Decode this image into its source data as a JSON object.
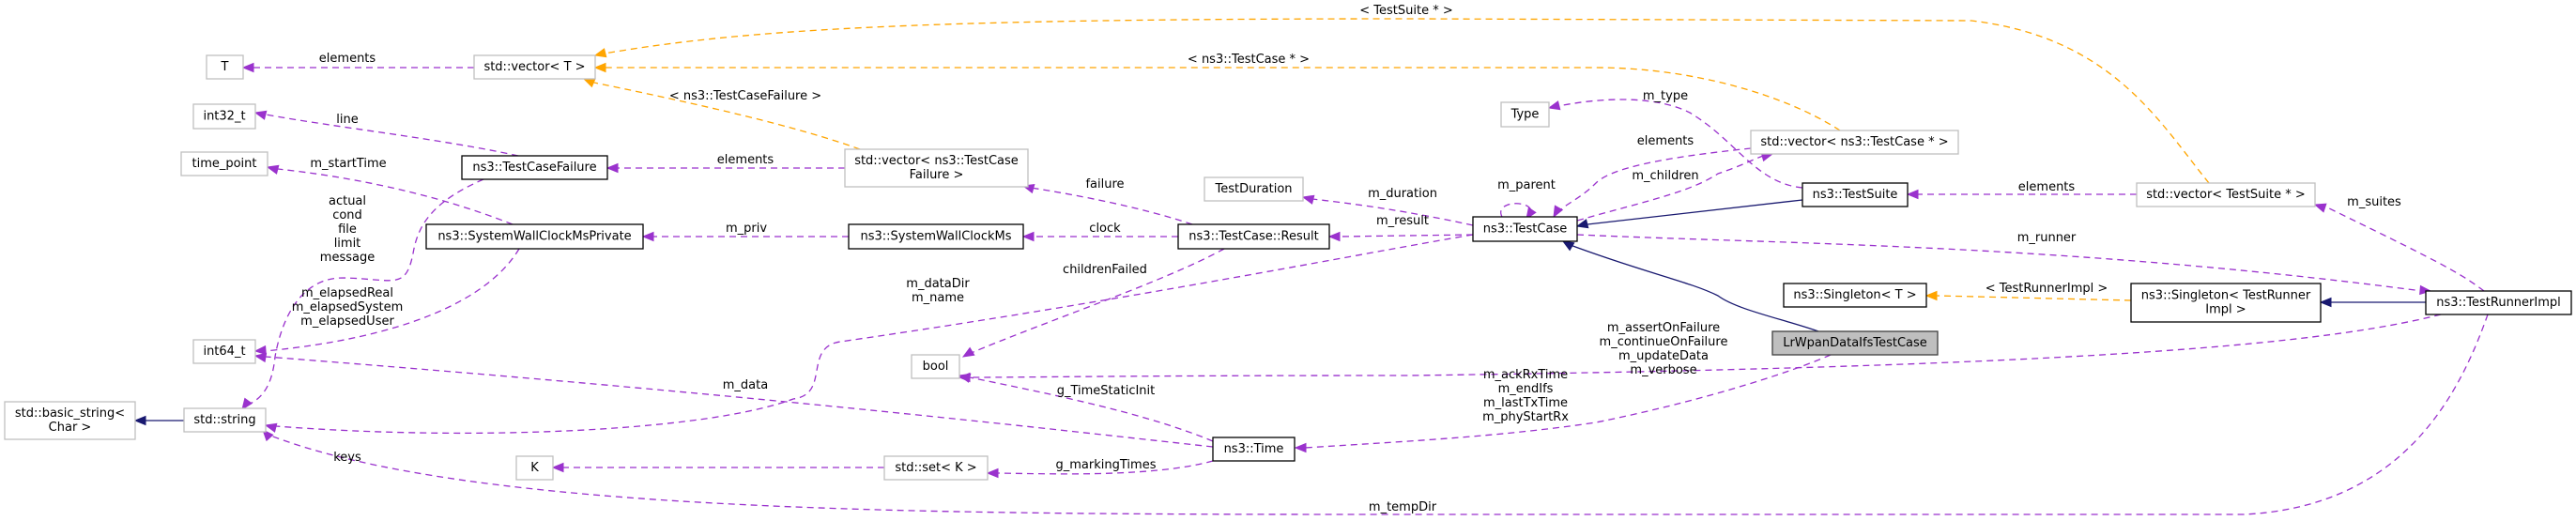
{
  "title": "LrWpanDataIfsTestCase collaboration diagram",
  "colors": {
    "usage_edge": "#9a32cd",
    "template_edge": "#ffa500",
    "inherit_edge": "#191970",
    "focus_fill": "#bfbfbf",
    "undocumented_border": "#bfbfbf",
    "documented_border": "#000000"
  },
  "nodes": [
    {
      "id": "T",
      "lines": [
        "T"
      ],
      "kind": "undoc"
    },
    {
      "id": "vectorT",
      "lines": [
        "std::vector< T >"
      ],
      "kind": "undoc"
    },
    {
      "id": "int32",
      "lines": [
        "int32_t"
      ],
      "kind": "undoc"
    },
    {
      "id": "timepoint",
      "lines": [
        "time_point"
      ],
      "kind": "undoc"
    },
    {
      "id": "tcfailure",
      "lines": [
        "ns3::TestCaseFailure"
      ],
      "kind": "doc"
    },
    {
      "id": "swcmp",
      "lines": [
        "ns3::SystemWallClockMsPrivate"
      ],
      "kind": "doc"
    },
    {
      "id": "int64",
      "lines": [
        "int64_t"
      ],
      "kind": "undoc"
    },
    {
      "id": "basicstring",
      "lines": [
        "std::basic_string<",
        "Char >"
      ],
      "kind": "undoc"
    },
    {
      "id": "string",
      "lines": [
        "std::string"
      ],
      "kind": "undoc"
    },
    {
      "id": "K",
      "lines": [
        "K"
      ],
      "kind": "undoc"
    },
    {
      "id": "vecfailure",
      "lines": [
        "std::vector< ns3::TestCase",
        "Failure >"
      ],
      "kind": "undoc"
    },
    {
      "id": "swcm",
      "lines": [
        "ns3::SystemWallClockMs"
      ],
      "kind": "doc"
    },
    {
      "id": "duration",
      "lines": [
        "TestDuration"
      ],
      "kind": "undoc"
    },
    {
      "id": "result",
      "lines": [
        "ns3::TestCase::Result"
      ],
      "kind": "doc"
    },
    {
      "id": "bool",
      "lines": [
        "bool"
      ],
      "kind": "undoc"
    },
    {
      "id": "time",
      "lines": [
        "ns3::Time"
      ],
      "kind": "doc"
    },
    {
      "id": "setK",
      "lines": [
        "std::set< K >"
      ],
      "kind": "undoc"
    },
    {
      "id": "type",
      "lines": [
        "Type"
      ],
      "kind": "undoc"
    },
    {
      "id": "testcase",
      "lines": [
        "ns3::TestCase"
      ],
      "kind": "doc"
    },
    {
      "id": "vectc",
      "lines": [
        "std::vector< ns3::TestCase * >"
      ],
      "kind": "undoc"
    },
    {
      "id": "testsuite",
      "lines": [
        "ns3::TestSuite"
      ],
      "kind": "doc"
    },
    {
      "id": "singletonT",
      "lines": [
        "ns3::Singleton< T >"
      ],
      "kind": "doc"
    },
    {
      "id": "lrwpan",
      "lines": [
        "LrWpanDataIfsTestCase"
      ],
      "kind": "focus"
    },
    {
      "id": "vects",
      "lines": [
        "std::vector< TestSuite * >"
      ],
      "kind": "undoc"
    },
    {
      "id": "singletonTR",
      "lines": [
        "ns3::Singleton< TestRunner",
        "Impl >"
      ],
      "kind": "doc"
    },
    {
      "id": "runner",
      "lines": [
        "ns3::TestRunnerImpl"
      ],
      "kind": "doc"
    }
  ],
  "edges": [
    {
      "id": "e1",
      "from": "vectorT",
      "to": "T",
      "type": "usage",
      "label": [
        "elements"
      ]
    },
    {
      "id": "e2",
      "from": "tcfailure",
      "to": "int32",
      "type": "usage",
      "label": [
        "line"
      ]
    },
    {
      "id": "e3",
      "from": "swcmp",
      "to": "timepoint",
      "type": "usage",
      "label": [
        "m_startTime"
      ]
    },
    {
      "id": "e4",
      "from": "tcfailure",
      "to": "string",
      "type": "usage",
      "label": [
        "actual",
        "cond",
        "file",
        "limit",
        "message"
      ]
    },
    {
      "id": "e5",
      "from": "swcmp",
      "to": "int64",
      "type": "usage",
      "label": [
        "m_elapsedReal",
        "m_elapsedSystem",
        "m_elapsedUser"
      ]
    },
    {
      "id": "e6",
      "from": "string",
      "to": "basicstring",
      "type": "inherit",
      "label": []
    },
    {
      "id": "e7",
      "from": "setK",
      "to": "K",
      "type": "usage",
      "label": [
        "keys"
      ]
    },
    {
      "id": "e8",
      "from": "vecfailure",
      "to": "tcfailure",
      "type": "usage",
      "label": [
        "elements"
      ]
    },
    {
      "id": "e9",
      "from": "vecfailure",
      "to": "vectorT",
      "type": "template",
      "label": [
        "< ns3::TestCaseFailure >"
      ]
    },
    {
      "id": "e10",
      "from": "swcm",
      "to": "swcmp",
      "type": "usage",
      "label": [
        "m_priv"
      ]
    },
    {
      "id": "e11",
      "from": "result",
      "to": "vecfailure",
      "type": "usage",
      "label": [
        "failure"
      ]
    },
    {
      "id": "e12",
      "from": "result",
      "to": "swcm",
      "type": "usage",
      "label": [
        "clock"
      ]
    },
    {
      "id": "e13",
      "from": "result",
      "to": "bool",
      "type": "usage",
      "label": [
        "childrenFailed"
      ]
    },
    {
      "id": "e14",
      "from": "testcase",
      "to": "string",
      "type": "usage",
      "label": [
        "m_dataDir",
        "m_name"
      ]
    },
    {
      "id": "e15",
      "from": "time",
      "to": "int64",
      "type": "usage",
      "label": [
        "m_data"
      ]
    },
    {
      "id": "e16",
      "from": "time",
      "to": "bool",
      "type": "usage",
      "label": [
        "g_TimeStaticInit"
      ]
    },
    {
      "id": "e17",
      "from": "time",
      "to": "setK",
      "type": "usage",
      "label": [
        "g_markingTimes"
      ]
    },
    {
      "id": "e18",
      "from": "testcase",
      "to": "duration",
      "type": "usage",
      "label": [
        "m_duration"
      ]
    },
    {
      "id": "e19",
      "from": "testcase",
      "to": "result",
      "type": "usage",
      "label": [
        "m_result"
      ]
    },
    {
      "id": "e20",
      "from": "testcase",
      "to": "testcase",
      "type": "usage",
      "label": [
        "m_parent"
      ]
    },
    {
      "id": "e21",
      "from": "testsuite",
      "to": "type",
      "type": "usage",
      "label": [
        "m_type"
      ]
    },
    {
      "id": "e22",
      "from": "vectc",
      "to": "testcase",
      "type": "usage",
      "label": [
        "elements"
      ]
    },
    {
      "id": "e23",
      "from": "testcase",
      "to": "vectc",
      "type": "usage",
      "label": [
        "m_children"
      ]
    },
    {
      "id": "e24",
      "from": "vectc",
      "to": "vectorT",
      "type": "template",
      "label": [
        "< ns3::TestCase * >"
      ]
    },
    {
      "id": "e25",
      "from": "vects",
      "to": "vectorT",
      "type": "template",
      "label": [
        "< TestSuite * >"
      ]
    },
    {
      "id": "e26",
      "from": "testsuite",
      "to": "testcase",
      "type": "inherit",
      "label": []
    },
    {
      "id": "e27",
      "from": "lrwpan",
      "to": "testcase",
      "type": "inherit",
      "label": []
    },
    {
      "id": "e28",
      "from": "lrwpan",
      "to": "time",
      "type": "usage",
      "label": [
        "m_ackRxTime",
        "m_endIfs",
        "m_lastTxTime",
        "m_phyStartRx"
      ]
    },
    {
      "id": "e29",
      "from": "runner",
      "to": "bool",
      "type": "usage",
      "label": [
        "m_assertOnFailure",
        "m_continueOnFailure",
        "m_updateData",
        "m_verbose"
      ]
    },
    {
      "id": "e30",
      "from": "vects",
      "to": "testsuite",
      "type": "usage",
      "label": [
        "elements"
      ]
    },
    {
      "id": "e31",
      "from": "testcase",
      "to": "runner",
      "type": "usage",
      "label": [
        "m_runner"
      ]
    },
    {
      "id": "e32",
      "from": "runner",
      "to": "vects",
      "type": "usage",
      "label": [
        "m_suites"
      ]
    },
    {
      "id": "e33",
      "from": "singletonTR",
      "to": "singletonT",
      "type": "template",
      "label": [
        "< TestRunnerImpl >"
      ]
    },
    {
      "id": "e34",
      "from": "runner",
      "to": "singletonTR",
      "type": "inherit",
      "label": []
    },
    {
      "id": "e35",
      "from": "runner",
      "to": "string",
      "type": "usage",
      "label": [
        "m_tempDir"
      ]
    }
  ]
}
